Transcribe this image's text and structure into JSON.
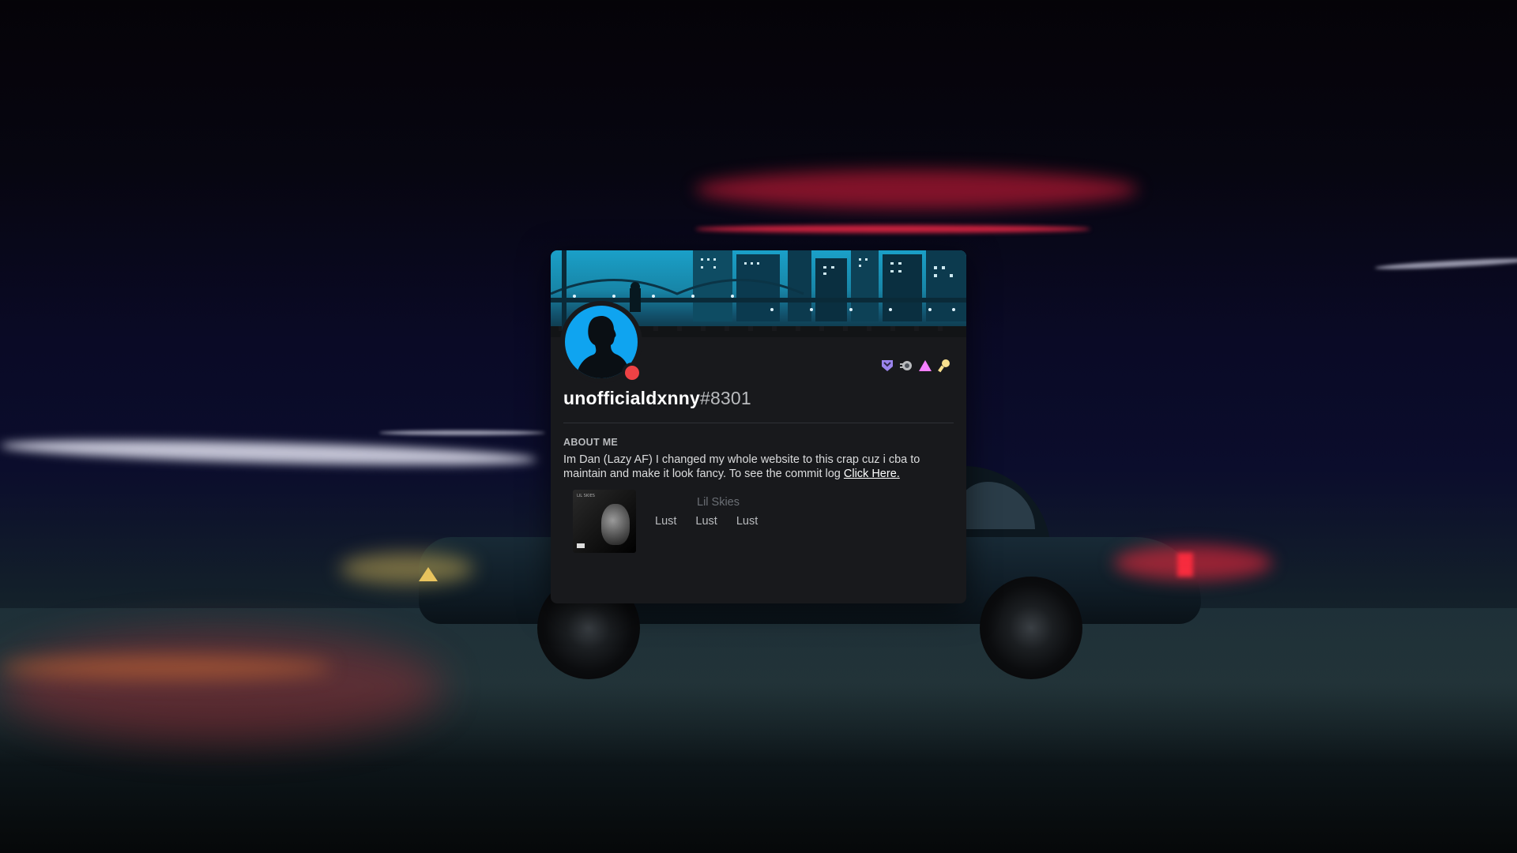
{
  "profile": {
    "username": "unofficialdxnny",
    "discriminator": "#8301",
    "status": "dnd",
    "status_color": "#ed4245",
    "avatar_color": "#0fa4f0",
    "badges": [
      "hypesquad-balance-icon",
      "nitro-icon",
      "early-supporter-icon",
      "bug-hunter-icon"
    ]
  },
  "about": {
    "title": "ABOUT ME",
    "text": "Im Dan (Lazy AF) I changed my whole website to this crap cuz i cba to maintain and make it look fancy. To see the commit log ",
    "link_label": "Click Here."
  },
  "activity": {
    "artist": "Lil Skies",
    "tracks": [
      "Lust",
      "Lust",
      "Lust"
    ],
    "album_text": "LIL SKIES"
  },
  "colors": {
    "card_bg": "#18191c",
    "banner_accent": "#1aa0c8"
  }
}
